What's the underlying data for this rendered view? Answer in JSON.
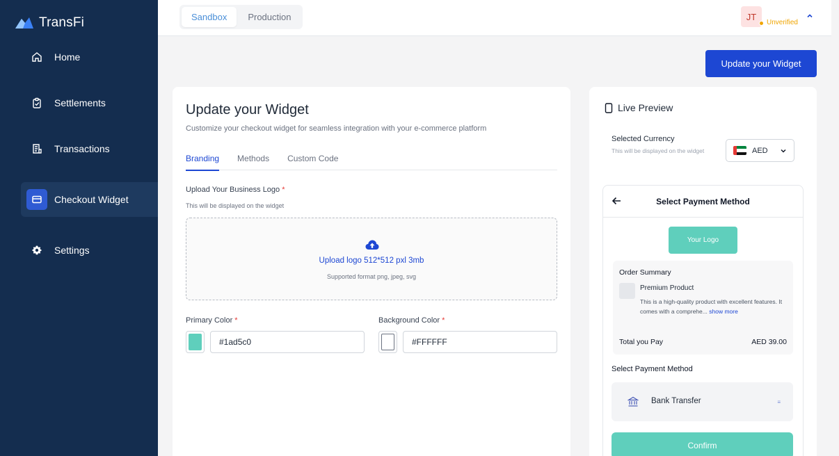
{
  "sidebar": {
    "brand": "TransFi",
    "items": [
      {
        "label": "Home"
      },
      {
        "label": "Settlements"
      },
      {
        "label": "Transactions"
      },
      {
        "label": "Checkout Widget"
      },
      {
        "label": "Settings"
      }
    ]
  },
  "topbar": {
    "env_tabs": [
      {
        "label": "Sandbox"
      },
      {
        "label": "Production"
      }
    ],
    "user_initials": "JT",
    "user_status": "Unverified"
  },
  "header_button": "Update your Widget",
  "editor": {
    "title": "Update your Widget",
    "subtitle": "Customize your checkout widget for seamless integration with your e-commerce platform",
    "tabs": [
      {
        "label": "Branding"
      },
      {
        "label": "Methods"
      },
      {
        "label": "Custom Code"
      }
    ],
    "logo": {
      "label": "Upload Your Business Logo",
      "required_mark": "*",
      "hint": "This will be displayed on the widget",
      "upload_text": "Upload logo 512*512 pxl 3mb",
      "formats": "Supported format png, jpeg, svg"
    },
    "primary_color": {
      "label": "Primary Color",
      "required_mark": "*",
      "value": "#1ad5c0"
    },
    "background_color": {
      "label": "Background Color",
      "required_mark": "*",
      "value": "#FFFFFF"
    }
  },
  "preview": {
    "title": "Live Preview",
    "currency_label": "Selected Currency",
    "currency_hint": "This will be displayed on the widget",
    "currency": "AED",
    "widget": {
      "header": "Select Payment Method",
      "logo_text": "Your Logo",
      "order_title": "Order Summary",
      "product_name": "Premium Product",
      "product_desc": "This is a high-quality product with excellent features. It comes with a comprehe...",
      "show_more": "show more",
      "total_label": "Total you Pay",
      "total_value": "AED 39.00",
      "pm_title": "Select Payment Method",
      "pm_option": "Bank Transfer",
      "pm_badge": "≡",
      "confirm": "Confirm"
    }
  },
  "colors": {
    "sidebar_bg": "#142d4f",
    "accent": "#1d47d3",
    "preview_primary": "#5fcfbc",
    "primary_swatch": "#5fcfbc",
    "background_swatch": "#FFFFFF",
    "warning": "#f0a500"
  },
  "icons": [
    "transfi-logo",
    "home-icon",
    "clipboard-check-icon",
    "receipt-icon",
    "card-icon",
    "gear-icon",
    "chevron-up-icon",
    "cloud-upload-icon",
    "phone-icon",
    "chevron-down-icon",
    "arrow-left-icon",
    "bank-icon"
  ]
}
